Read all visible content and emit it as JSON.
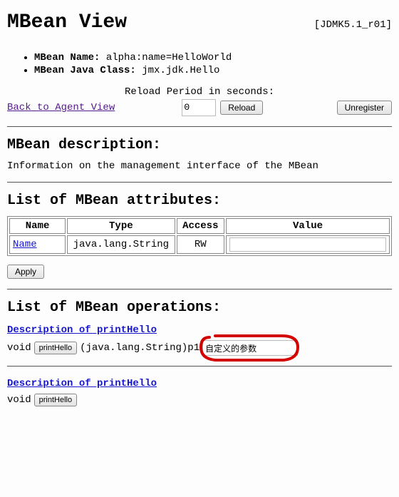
{
  "header": {
    "title": "MBean View",
    "version": "[JDMK5.1_r01]"
  },
  "bean": {
    "name_label": "MBean Name:",
    "name_value": "alpha:name=HelloWorld",
    "class_label": "MBean Java Class:",
    "class_value": "jmx.jdk.Hello"
  },
  "reload": {
    "label": "Reload Period in seconds:",
    "back_link": "Back to Agent View",
    "value": "0",
    "reload_btn": "Reload",
    "unregister_btn": "Unregister"
  },
  "desc_section": {
    "heading": "MBean description:",
    "text": "Information on the management interface of the MBean"
  },
  "attr_section": {
    "heading": "List of MBean attributes:",
    "cols": {
      "name": "Name",
      "type": "Type",
      "access": "Access",
      "value": "Value"
    },
    "row1": {
      "name": "Name",
      "type": "java.lang.String",
      "access": "RW",
      "value": ""
    },
    "apply_btn": "Apply"
  },
  "ops_section": {
    "heading": "List of MBean operations:",
    "op1": {
      "desc_link": "Description of printHello",
      "ret": "void",
      "btn": "printHello",
      "param_text_a": "(java.lang.String)p1",
      "param_value": "自定义的参数"
    },
    "op2": {
      "desc_link": "Description of printHello",
      "ret": "void",
      "btn": "printHello"
    }
  }
}
